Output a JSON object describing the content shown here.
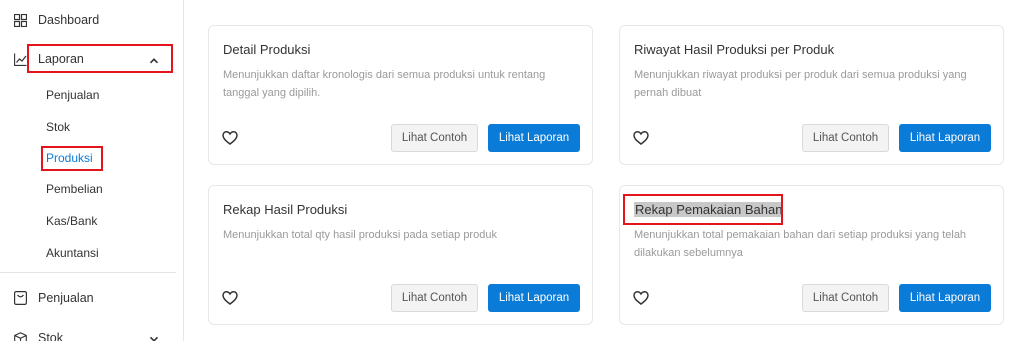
{
  "sidebar": {
    "dashboard": {
      "label": "Dashboard",
      "icon": "grid-icon"
    },
    "laporan": {
      "label": "Laporan",
      "icon": "line-chart-icon"
    },
    "sub_items": [
      "Penjualan",
      "Stok",
      "Produksi",
      "Pembelian",
      "Kas/Bank",
      "Akuntansi"
    ],
    "active_sub": "Produksi",
    "penjualan": {
      "label": "Penjualan",
      "icon": "bag-icon"
    },
    "stok": {
      "label": "Stok",
      "icon": "box-icon"
    }
  },
  "cards": [
    {
      "title": "Detail Produksi",
      "desc": "Menunjukkan daftar kronologis dari semua produksi untuk rentang tanggal yang dipilih."
    },
    {
      "title": "Riwayat Hasil Produksi per Produk",
      "desc": "Menunjukkan riwayat produksi per produk dari semua produksi yang pernah dibuat"
    },
    {
      "title": "Rekap Hasil Produksi",
      "desc": "Menunjukkan total qty hasil produksi pada setiap produk"
    },
    {
      "title": "Rekap Pemakaian Bahan",
      "desc": "Menunjukkan total pemakaian bahan dari setiap produksi yang telah dilakukan sebelumnya"
    }
  ],
  "buttons": {
    "sample_label": "Lihat Contoh",
    "report_label": "Lihat Laporan"
  },
  "colors": {
    "accent": "#0b7bd8",
    "active_link": "#0b7bd8",
    "highlight_box": "#e3141b",
    "desc_text": "#9a9a9a"
  }
}
